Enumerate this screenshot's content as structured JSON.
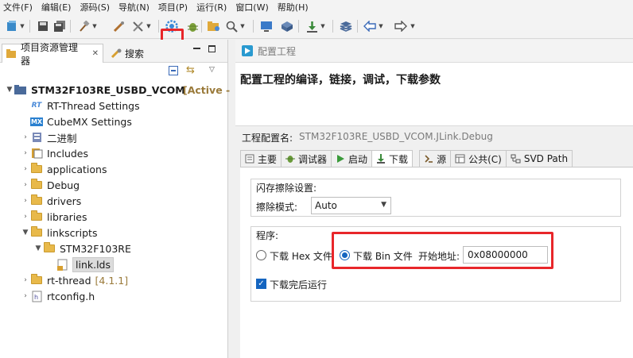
{
  "menu": [
    "文件(F)",
    "编辑(E)",
    "源码(S)",
    "导航(N)",
    "项目(P)",
    "运行(R)",
    "窗口(W)",
    "帮助(H)"
  ],
  "left_panel": {
    "tab_explorer": "项目资源管理器",
    "tab_search": "搜索",
    "tree": [
      {
        "label": "STM32F103RE_USBD_VCOM",
        "extra": "[Active -",
        "level": 0,
        "open": true,
        "icon": "project-icon"
      },
      {
        "label": "RT-Thread Settings",
        "level": 1,
        "icon": "rt-thread-icon"
      },
      {
        "label": "CubeMX Settings",
        "level": 1,
        "icon": "cubemx-icon"
      },
      {
        "label": "二进制",
        "level": 1,
        "icon": "binaries-icon",
        "collapsed": true
      },
      {
        "label": "Includes",
        "level": 1,
        "icon": "includes-icon",
        "collapsed": true
      },
      {
        "label": "applications",
        "level": 1,
        "icon": "folder-icon",
        "collapsed": true
      },
      {
        "label": "Debug",
        "level": 1,
        "icon": "folder-icon",
        "collapsed": true
      },
      {
        "label": "drivers",
        "level": 1,
        "icon": "folder-icon",
        "collapsed": true
      },
      {
        "label": "libraries",
        "level": 1,
        "icon": "folder-icon",
        "collapsed": true
      },
      {
        "label": "linkscripts",
        "level": 1,
        "icon": "folder-icon",
        "open": true
      },
      {
        "label": "STM32F103RE",
        "level": 2,
        "icon": "folder-icon",
        "open": true
      },
      {
        "label": "link.lds",
        "level": 3,
        "icon": "file-icon",
        "selected": true
      },
      {
        "label": "rt-thread",
        "extra": "[4.1.1]",
        "level": 1,
        "icon": "folder-icon",
        "collapsed": true
      },
      {
        "label": "rtconfig.h",
        "level": 1,
        "icon": "header-file-icon",
        "collapsed": true
      }
    ]
  },
  "right_panel": {
    "header": "配置工程",
    "banner": "配置工程的编译，链接，调试，下载参数",
    "config_name_label": "工程配置名:",
    "config_name_value": "STM32F103RE_USBD_VCOM.JLink.Debug",
    "tabs": [
      "主要",
      "调试器",
      "启动",
      "下载",
      "源",
      "公共(C)",
      "SVD Path"
    ],
    "flash_group": {
      "title": "闪存擦除设置:",
      "erase_mode_label": "擦除模式:",
      "erase_mode_value": "Auto"
    },
    "program_group": {
      "title": "程序:",
      "hex_option": "下载 Hex 文件",
      "bin_option": "下载 Bin 文件",
      "start_addr_label": "开始地址:",
      "start_addr_value": "0x08000000"
    },
    "run_after_download": "下载完后运行"
  },
  "colors": {
    "highlight": "#e8262a",
    "accent": "#1565c0"
  }
}
